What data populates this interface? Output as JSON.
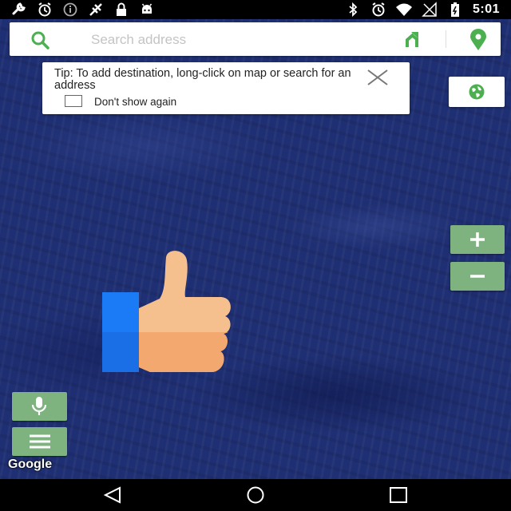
{
  "status_bar": {
    "time": "5:01",
    "icons_left": [
      "wrench-icon",
      "alarm-icon",
      "info-icon",
      "gps-icon",
      "lock-icon",
      "android-icon"
    ],
    "icons_right": [
      "bluetooth-icon",
      "alarm-icon",
      "wifi-icon",
      "signal-icon",
      "battery-icon"
    ]
  },
  "search": {
    "placeholder": "Search address",
    "value": ""
  },
  "tip": {
    "text": "Tip: To add destination, long-click on map or search for an address",
    "checkbox_label": "Don't show again",
    "checkbox_checked": false
  },
  "map": {
    "label": "Google"
  },
  "colors": {
    "accent_green": "#4caf50",
    "button_green": "#7eb27e",
    "map_blue": "#1f2f73"
  }
}
